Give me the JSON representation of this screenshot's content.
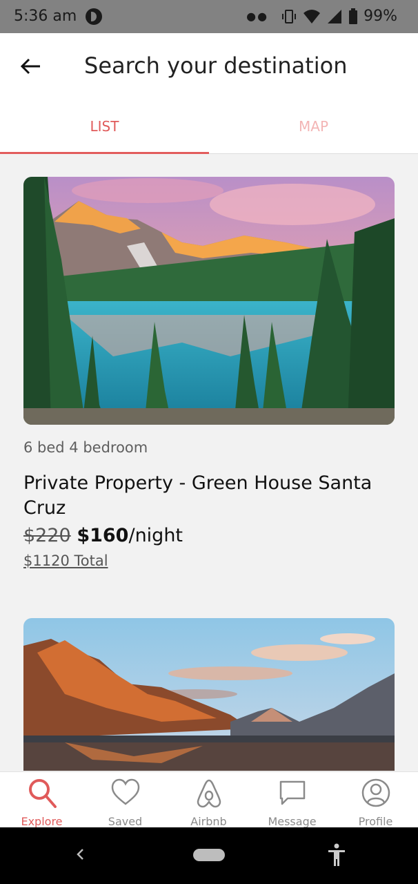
{
  "status_bar": {
    "time": "5:36 am",
    "battery": "99%"
  },
  "header": {
    "title": "Search your destination"
  },
  "tabs": [
    {
      "label": "LIST",
      "active": true
    },
    {
      "label": "MAP",
      "active": false
    }
  ],
  "listings": [
    {
      "image": "mountain-lake-sunrise",
      "meta": "6 bed 4 bedroom",
      "title": "Private Property - Green House Santa Cruz",
      "old_price": "$220",
      "new_price": "$160",
      "price_unit": "/night",
      "total": "$1120 Total"
    },
    {
      "image": "mountain-lake-sunset"
    }
  ],
  "bottom_nav": [
    {
      "label": "Explore",
      "icon": "search-icon",
      "active": true
    },
    {
      "label": "Saved",
      "icon": "heart-icon",
      "active": false
    },
    {
      "label": "Airbnb",
      "icon": "airbnb-logo-icon",
      "active": false
    },
    {
      "label": "Message",
      "icon": "message-icon",
      "active": false
    },
    {
      "label": "Profile",
      "icon": "profile-icon",
      "active": false
    }
  ],
  "colors": {
    "accent": "#e05a5a",
    "status_bar": "#828282",
    "background": "#f2f2f2"
  }
}
